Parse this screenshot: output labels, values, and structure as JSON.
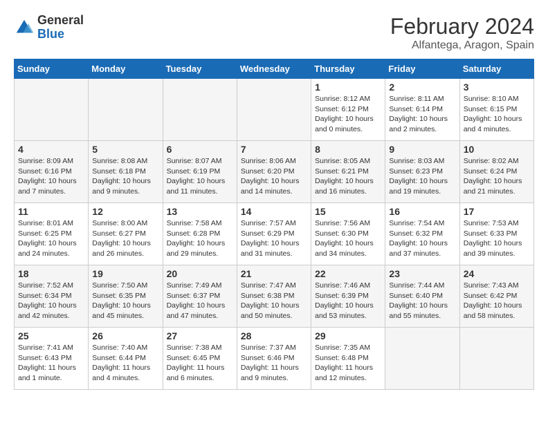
{
  "header": {
    "logo_general": "General",
    "logo_blue": "Blue",
    "month_year": "February 2024",
    "location": "Alfantega, Aragon, Spain"
  },
  "days_of_week": [
    "Sunday",
    "Monday",
    "Tuesday",
    "Wednesday",
    "Thursday",
    "Friday",
    "Saturday"
  ],
  "weeks": [
    [
      {
        "day": "",
        "empty": true
      },
      {
        "day": "",
        "empty": true
      },
      {
        "day": "",
        "empty": true
      },
      {
        "day": "",
        "empty": true
      },
      {
        "day": "1",
        "sunrise": "Sunrise: 8:12 AM",
        "sunset": "Sunset: 6:12 PM",
        "daylight": "Daylight: 10 hours and 0 minutes."
      },
      {
        "day": "2",
        "sunrise": "Sunrise: 8:11 AM",
        "sunset": "Sunset: 6:14 PM",
        "daylight": "Daylight: 10 hours and 2 minutes."
      },
      {
        "day": "3",
        "sunrise": "Sunrise: 8:10 AM",
        "sunset": "Sunset: 6:15 PM",
        "daylight": "Daylight: 10 hours and 4 minutes."
      }
    ],
    [
      {
        "day": "4",
        "sunrise": "Sunrise: 8:09 AM",
        "sunset": "Sunset: 6:16 PM",
        "daylight": "Daylight: 10 hours and 7 minutes."
      },
      {
        "day": "5",
        "sunrise": "Sunrise: 8:08 AM",
        "sunset": "Sunset: 6:18 PM",
        "daylight": "Daylight: 10 hours and 9 minutes."
      },
      {
        "day": "6",
        "sunrise": "Sunrise: 8:07 AM",
        "sunset": "Sunset: 6:19 PM",
        "daylight": "Daylight: 10 hours and 11 minutes."
      },
      {
        "day": "7",
        "sunrise": "Sunrise: 8:06 AM",
        "sunset": "Sunset: 6:20 PM",
        "daylight": "Daylight: 10 hours and 14 minutes."
      },
      {
        "day": "8",
        "sunrise": "Sunrise: 8:05 AM",
        "sunset": "Sunset: 6:21 PM",
        "daylight": "Daylight: 10 hours and 16 minutes."
      },
      {
        "day": "9",
        "sunrise": "Sunrise: 8:03 AM",
        "sunset": "Sunset: 6:23 PM",
        "daylight": "Daylight: 10 hours and 19 minutes."
      },
      {
        "day": "10",
        "sunrise": "Sunrise: 8:02 AM",
        "sunset": "Sunset: 6:24 PM",
        "daylight": "Daylight: 10 hours and 21 minutes."
      }
    ],
    [
      {
        "day": "11",
        "sunrise": "Sunrise: 8:01 AM",
        "sunset": "Sunset: 6:25 PM",
        "daylight": "Daylight: 10 hours and 24 minutes."
      },
      {
        "day": "12",
        "sunrise": "Sunrise: 8:00 AM",
        "sunset": "Sunset: 6:27 PM",
        "daylight": "Daylight: 10 hours and 26 minutes."
      },
      {
        "day": "13",
        "sunrise": "Sunrise: 7:58 AM",
        "sunset": "Sunset: 6:28 PM",
        "daylight": "Daylight: 10 hours and 29 minutes."
      },
      {
        "day": "14",
        "sunrise": "Sunrise: 7:57 AM",
        "sunset": "Sunset: 6:29 PM",
        "daylight": "Daylight: 10 hours and 31 minutes."
      },
      {
        "day": "15",
        "sunrise": "Sunrise: 7:56 AM",
        "sunset": "Sunset: 6:30 PM",
        "daylight": "Daylight: 10 hours and 34 minutes."
      },
      {
        "day": "16",
        "sunrise": "Sunrise: 7:54 AM",
        "sunset": "Sunset: 6:32 PM",
        "daylight": "Daylight: 10 hours and 37 minutes."
      },
      {
        "day": "17",
        "sunrise": "Sunrise: 7:53 AM",
        "sunset": "Sunset: 6:33 PM",
        "daylight": "Daylight: 10 hours and 39 minutes."
      }
    ],
    [
      {
        "day": "18",
        "sunrise": "Sunrise: 7:52 AM",
        "sunset": "Sunset: 6:34 PM",
        "daylight": "Daylight: 10 hours and 42 minutes."
      },
      {
        "day": "19",
        "sunrise": "Sunrise: 7:50 AM",
        "sunset": "Sunset: 6:35 PM",
        "daylight": "Daylight: 10 hours and 45 minutes."
      },
      {
        "day": "20",
        "sunrise": "Sunrise: 7:49 AM",
        "sunset": "Sunset: 6:37 PM",
        "daylight": "Daylight: 10 hours and 47 minutes."
      },
      {
        "day": "21",
        "sunrise": "Sunrise: 7:47 AM",
        "sunset": "Sunset: 6:38 PM",
        "daylight": "Daylight: 10 hours and 50 minutes."
      },
      {
        "day": "22",
        "sunrise": "Sunrise: 7:46 AM",
        "sunset": "Sunset: 6:39 PM",
        "daylight": "Daylight: 10 hours and 53 minutes."
      },
      {
        "day": "23",
        "sunrise": "Sunrise: 7:44 AM",
        "sunset": "Sunset: 6:40 PM",
        "daylight": "Daylight: 10 hours and 55 minutes."
      },
      {
        "day": "24",
        "sunrise": "Sunrise: 7:43 AM",
        "sunset": "Sunset: 6:42 PM",
        "daylight": "Daylight: 10 hours and 58 minutes."
      }
    ],
    [
      {
        "day": "25",
        "sunrise": "Sunrise: 7:41 AM",
        "sunset": "Sunset: 6:43 PM",
        "daylight": "Daylight: 11 hours and 1 minute."
      },
      {
        "day": "26",
        "sunrise": "Sunrise: 7:40 AM",
        "sunset": "Sunset: 6:44 PM",
        "daylight": "Daylight: 11 hours and 4 minutes."
      },
      {
        "day": "27",
        "sunrise": "Sunrise: 7:38 AM",
        "sunset": "Sunset: 6:45 PM",
        "daylight": "Daylight: 11 hours and 6 minutes."
      },
      {
        "day": "28",
        "sunrise": "Sunrise: 7:37 AM",
        "sunset": "Sunset: 6:46 PM",
        "daylight": "Daylight: 11 hours and 9 minutes."
      },
      {
        "day": "29",
        "sunrise": "Sunrise: 7:35 AM",
        "sunset": "Sunset: 6:48 PM",
        "daylight": "Daylight: 11 hours and 12 minutes."
      },
      {
        "day": "",
        "empty": true
      },
      {
        "day": "",
        "empty": true
      }
    ]
  ]
}
